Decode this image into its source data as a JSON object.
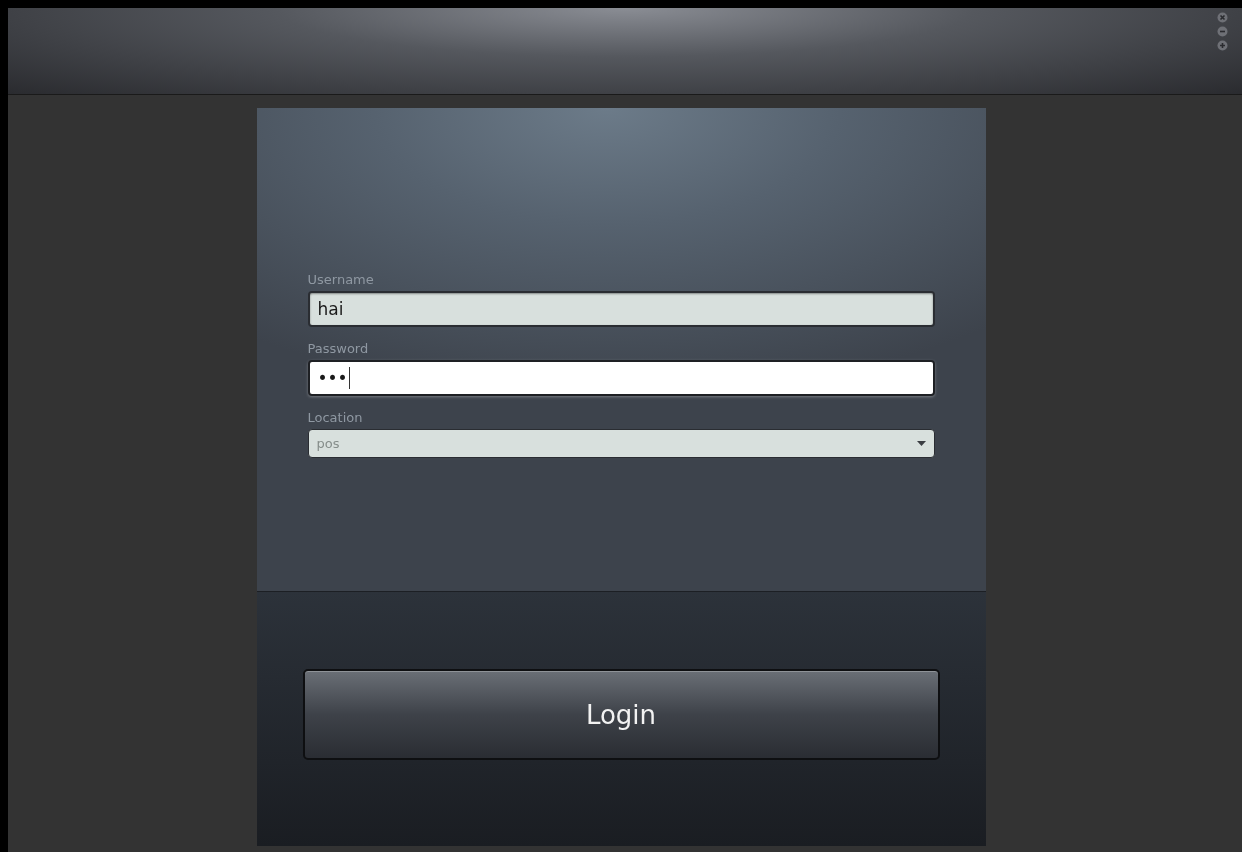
{
  "window": {
    "controls": [
      {
        "kind": "close"
      },
      {
        "kind": "minimize"
      },
      {
        "kind": "maximize"
      }
    ]
  },
  "form": {
    "fields": [
      {
        "kind": "text",
        "label": "Username",
        "value": "hai",
        "focused": false
      },
      {
        "kind": "text",
        "label": "Password",
        "value": "•••",
        "focused": true
      },
      {
        "kind": "select",
        "label": "Location",
        "value": "pos",
        "disabled": true
      }
    ],
    "login_button": "Login"
  }
}
